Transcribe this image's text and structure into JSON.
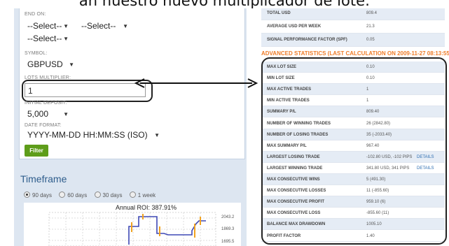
{
  "caption": "an nuestro nuevo multiplicador de lote:",
  "left_panel": {
    "end_on_label": "END ON:",
    "end_on_selects": [
      "--Select--",
      "--Select--",
      "--Select--"
    ],
    "symbol_label": "SYMBOL:",
    "symbol_value": "GBPUSD",
    "lots_label": "LOTS MULTIPLIER:",
    "lots_value": "1",
    "deposit_label": "INITIAL DEPOSIT:",
    "deposit_value": "5,000",
    "date_format_label": "DATE FORMAT:",
    "date_format_value": "YYYY-MM-DD HH:MM:SS (ISO)",
    "filter_button": "Filter",
    "timeframe_title": "Timeframe",
    "timeframe_options": [
      {
        "label": "90 days",
        "selected": true
      },
      {
        "label": "60 days",
        "selected": false
      },
      {
        "label": "30 days",
        "selected": false
      },
      {
        "label": "1 week",
        "selected": false
      }
    ],
    "chart_title": "Annual ROI: 387.91%",
    "chart_ticks": [
      "2043.2",
      "1869.3",
      "1695.5"
    ]
  },
  "right_panel": {
    "top_rows": [
      {
        "key": "TOTAL USD",
        "value": "809.4"
      },
      {
        "key": "AVERAGE USD PER WEEK",
        "value": "21.3"
      },
      {
        "key": "SIGNAL PERFORMANCE FACTOR (SPF)",
        "value": "0.05"
      }
    ],
    "advanced_title": "ADVANCED STATISTICS (LAST CALCULATION ON 2009-11-27 08:13:55)",
    "advanced_rows": [
      {
        "key": "MAX LOT SIZE",
        "value": "0.10"
      },
      {
        "key": "MIN LOT SIZE",
        "value": "0.10"
      },
      {
        "key": "MAX ACTIVE TRADES",
        "value": "1"
      },
      {
        "key": "MIN ACTIVE TRADES",
        "value": "1"
      },
      {
        "key": "SUMMARY P/L",
        "value": "809.40"
      },
      {
        "key": "NUMBER OF WINNING TRADES",
        "value": "26 (2842.80)"
      },
      {
        "key": "NUMBER OF LOSING TRADES",
        "value": "35 (-2033.40)"
      },
      {
        "key": "MAX SUMMARY P/L",
        "value": "967.40"
      },
      {
        "key": "LARGEST LOSING TRADE",
        "value": "-102.80 USD, -102 PIPS",
        "link": "DETAILS"
      },
      {
        "key": "LARGEST WINNING TRADE",
        "value": "341.80 USD, 341 PIPS",
        "link": "DETAILS"
      },
      {
        "key": "MAX CONSECUTIVE WINS",
        "value": "5 (491.30)"
      },
      {
        "key": "MAX CONSECUTIVE LOSSES",
        "value": "11 (-855.60)"
      },
      {
        "key": "MAX CONSECUTIVE PROFIT",
        "value": "959.10 (6)"
      },
      {
        "key": "MAX CONSECUTIVE LOSS",
        "value": "-855.60 (11)"
      },
      {
        "key": "BALANCE MAX DRAWDOWN",
        "value": "1005.10"
      },
      {
        "key": "PROFIT FACTOR",
        "value": "1.40"
      }
    ]
  },
  "colors": {
    "accent_orange": "#ef7d2a",
    "filter_green": "#5e9d1a",
    "link_blue": "#2b6cb0",
    "timeframe_blue": "#2e5d8c",
    "panel_bg": "#dde6f1"
  }
}
